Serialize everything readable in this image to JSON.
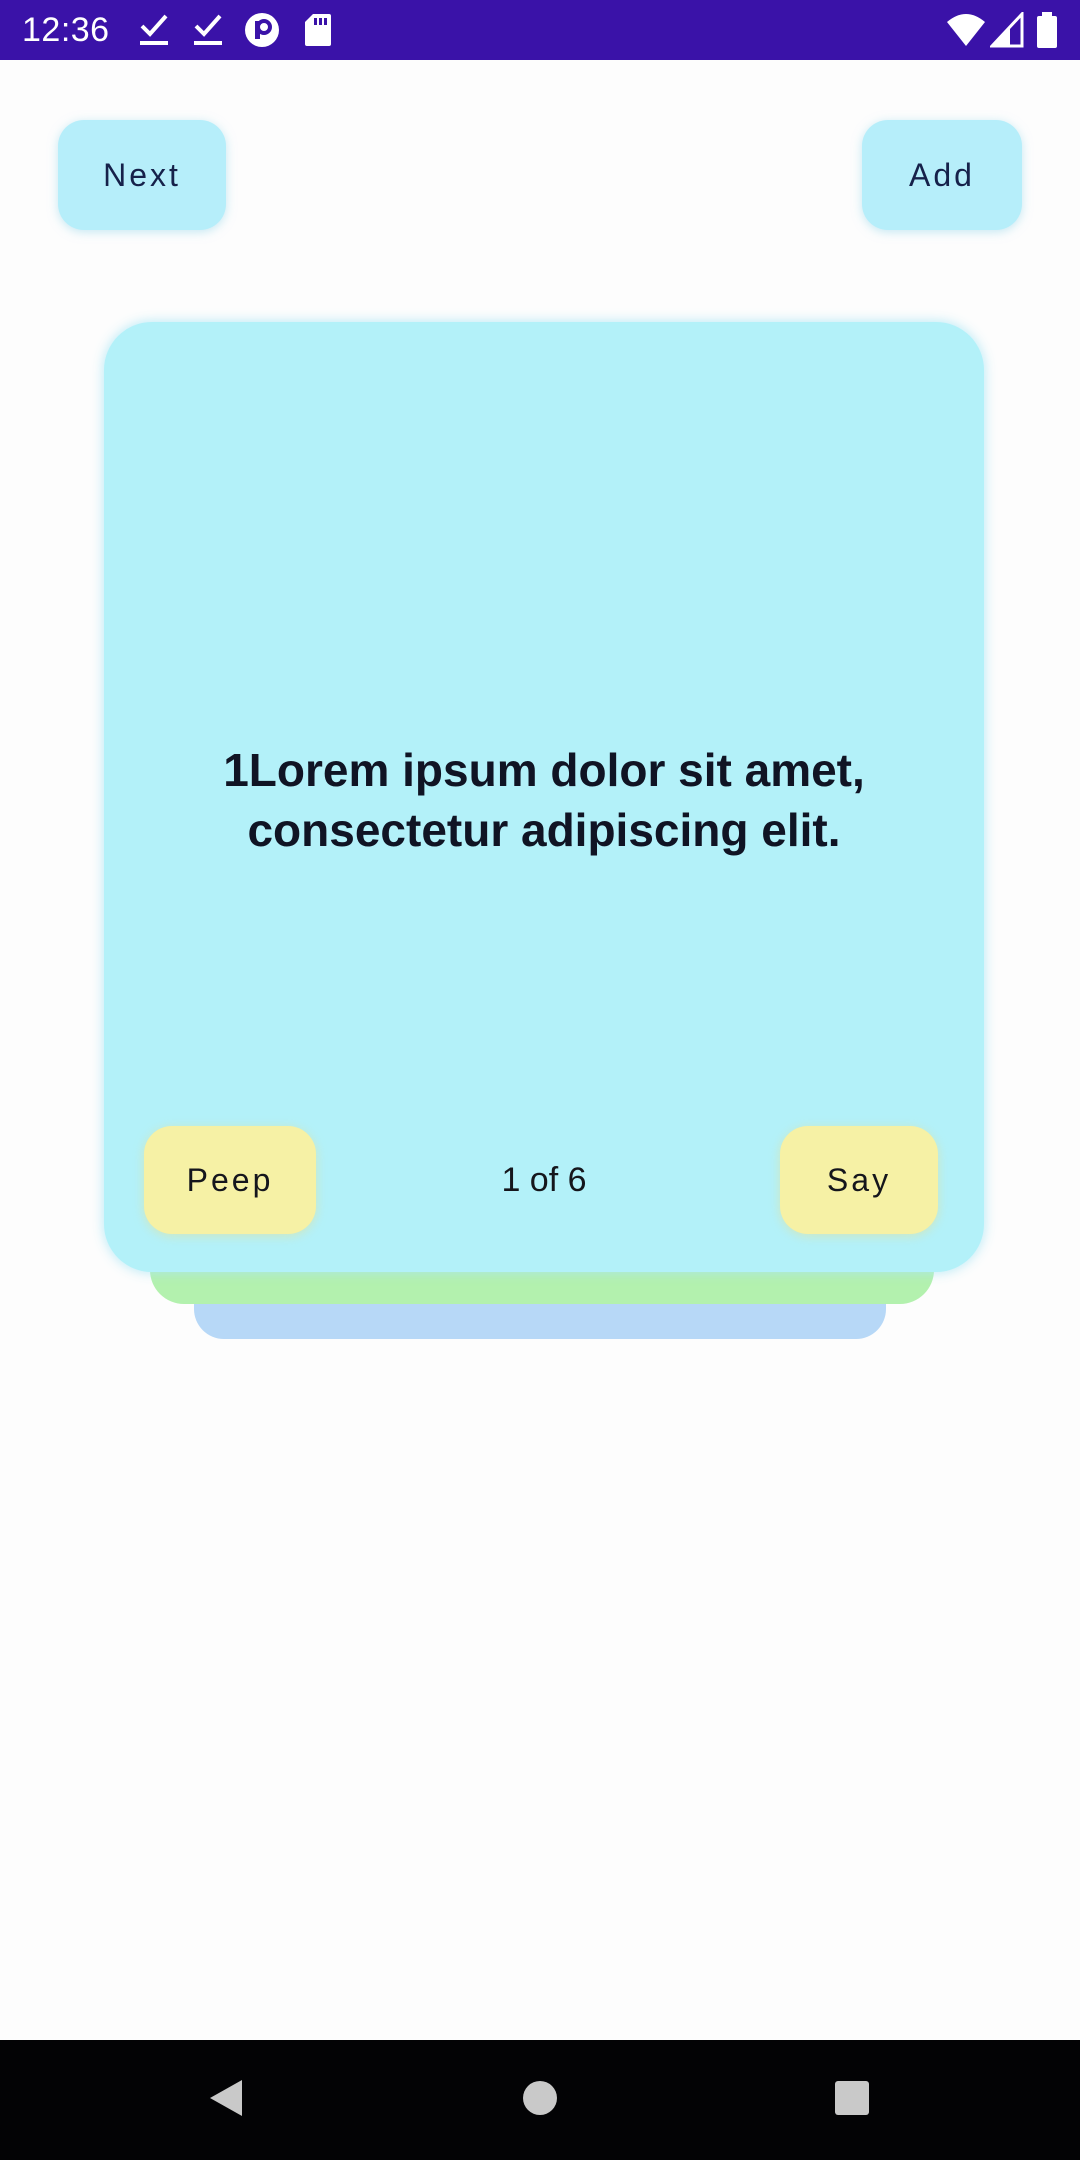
{
  "status_bar": {
    "time": "12:36",
    "left_icons": [
      "download-done-icon",
      "download-done-icon",
      "circle-p-icon",
      "sd-card-icon"
    ],
    "right_icons": [
      "wifi-icon",
      "signal-icon",
      "battery-icon"
    ],
    "color": "#3a12a8"
  },
  "toolbar": {
    "next_label": "Next",
    "add_label": "Add"
  },
  "card": {
    "text": "1Lorem ipsum dolor sit amet, consectetur adipiscing elit.",
    "peep_label": "Peep",
    "say_label": "Say",
    "counter": "1 of 6",
    "colors": {
      "front": "#b3f1f9",
      "back_1": "#b3f1ae",
      "back_2": "#b7d8f7",
      "button": "#f6f1a5"
    }
  },
  "nav_bar": {
    "icons": [
      "back-icon",
      "home-icon",
      "recents-icon"
    ]
  }
}
